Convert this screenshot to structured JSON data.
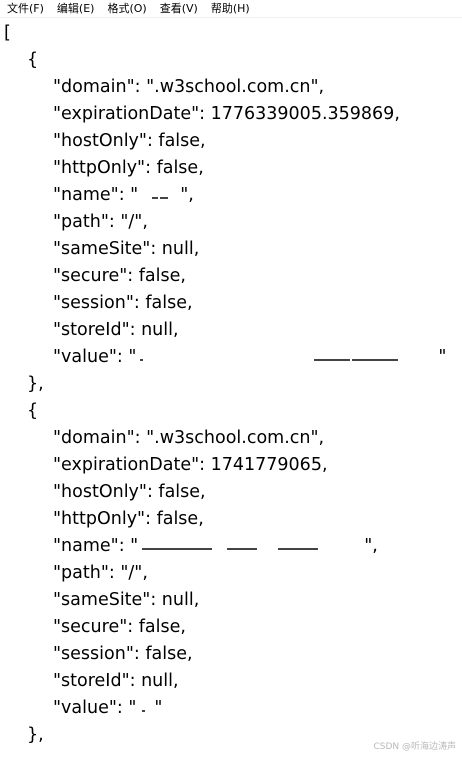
{
  "menu": {
    "file": "文件(F)",
    "edit": "编辑(E)",
    "format": "格式(O)",
    "view": "查看(V)",
    "help": "帮助(H)"
  },
  "document": {
    "open_bracket": "[",
    "records": [
      {
        "open": "{",
        "domain": "\"domain\": \".w3school.com.cn\",",
        "expirationDate": "\"expirationDate\": 1776339005.359869,",
        "hostOnly": "\"hostOnly\": false,",
        "httpOnly": "\"httpOnly\": false,",
        "name": "\"name\": \"",
        "name_tail": "\",",
        "path": "\"path\": \"/\",",
        "sameSite": "\"sameSite\": null,",
        "secure": "\"secure\": false,",
        "session": "\"session\": false,",
        "storeId": "\"storeId\": null,",
        "value": "\"value\": \"",
        "value_tail": "\"",
        "close": "},"
      },
      {
        "open": "{",
        "domain": "\"domain\": \".w3school.com.cn\",",
        "expirationDate": "\"expirationDate\": 1741779065,",
        "hostOnly": "\"hostOnly\": false,",
        "httpOnly": "\"httpOnly\": false,",
        "name": "\"name\": \"",
        "name_tail": "\",",
        "path": "\"path\": \"/\",",
        "sameSite": "\"sameSite\": null,",
        "secure": "\"secure\": false,",
        "session": "\"session\": false,",
        "storeId": "\"storeId\": null,",
        "value": "\"value\": \"",
        "value_tail": "\"",
        "close": "},"
      }
    ]
  },
  "watermark": "CSDN @听海边涛声"
}
